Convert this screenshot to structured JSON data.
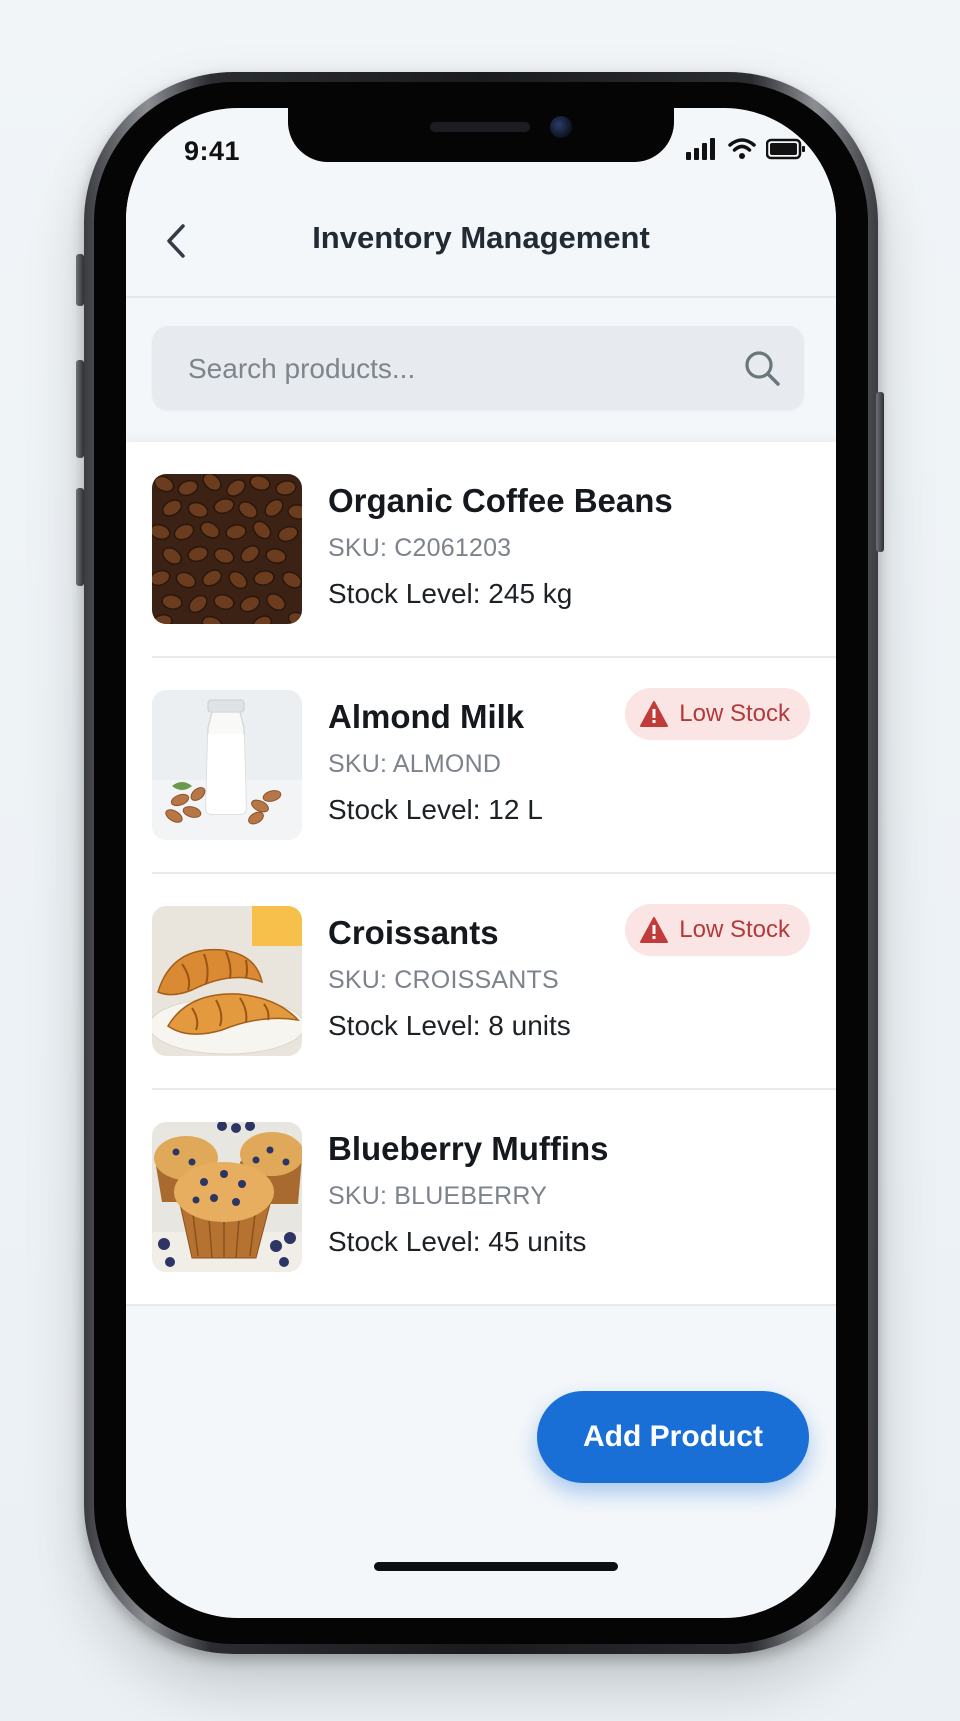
{
  "status_bar": {
    "time": "9:41",
    "icons": [
      "signal-icon",
      "wifi-icon",
      "battery-icon"
    ]
  },
  "header": {
    "title": "Inventory Management",
    "back_icon": "chevron-left-icon"
  },
  "search": {
    "placeholder": "Search products...",
    "value": "",
    "icon": "search-icon"
  },
  "products": [
    {
      "name": "Organic Coffee Beans",
      "sku": "SKU: C2061203",
      "stock": "Stock Level: 245 kg",
      "image": "coffee-beans-image",
      "badge": null
    },
    {
      "name": "Almond Milk",
      "sku": "SKU: ALMOND",
      "stock": "Stock Level: 12 L",
      "image": "almond-milk-image",
      "badge": "Low Stock"
    },
    {
      "name": "Croissants",
      "sku": "SKU: CROISSANTS",
      "stock": "Stock Level: 8 units",
      "image": "croissants-image",
      "badge": "Low Stock"
    },
    {
      "name": "Blueberry Muffins",
      "sku": "SKU: BLUEBERRY",
      "stock": "Stock Level: 45 units",
      "image": "blueberry-muffins-image",
      "badge": null
    }
  ],
  "actions": {
    "add_label": "Add Product"
  },
  "colors": {
    "accent": "#1a6fd6",
    "badge_bg": "#fbe4e4",
    "badge_text": "#b33a3a"
  }
}
